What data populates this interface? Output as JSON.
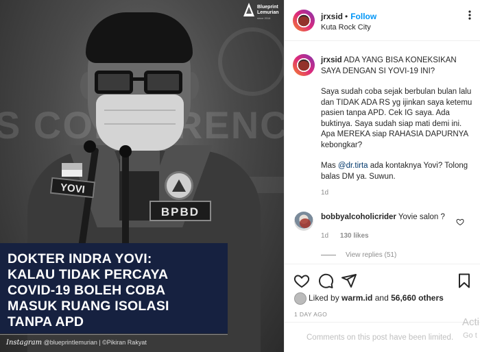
{
  "photo": {
    "background_text": "S CONFERENCE",
    "name_patch": "YOVI",
    "org_patch": "BPBD",
    "logo": {
      "line1": "Blueprint",
      "line2": "Lemurian",
      "tagline": "since 2016"
    },
    "headline": [
      "DOKTER INDRA YOVI:",
      "KALAU TIDAK PERCAYA",
      "COVID-19 BOLEH COBA",
      "MASUK RUANG ISOLASI",
      "TANPA APD"
    ],
    "credit": {
      "instagram": "Instagram",
      "text": "@blueprintlemurian | ©Pikiran Rakyat"
    }
  },
  "post": {
    "header": {
      "username": "jrxsid",
      "separator": "•",
      "follow": "Follow",
      "location": "Kuta Rock City"
    },
    "caption": {
      "username": "jrxsid",
      "first": "ADA YANG BISA KONEKSIKAN SAYA DENGAN SI YOVI-19 INI?",
      "para2": "Saya sudah coba sejak berbulan bulan lalu dan TIDAK ADA RS yg ijinkan saya ketemu pasien tanpa APD. Cek IG saya. Ada buktinya. Saya sudah siap mati demi ini. Apa MEREKA siap RAHASIA DAPURNYA kebongkar?",
      "para3_prefix": "Mas ",
      "mention": "@dr.tirta",
      "para3_suffix": " ada kontaknya Yovi? Tolong balas DM ya. Suwun.",
      "age": "1d"
    },
    "comment": {
      "username": "bobbyalcoholicrider",
      "text": "Yovie salon ?",
      "age": "1d",
      "likes": "130 likes",
      "view_replies": "View replies (51)"
    },
    "likes": {
      "prefix": "Liked by ",
      "user": "warm.id",
      "and": " and ",
      "others": "56,660 others"
    },
    "time_ago": "1 DAY AGO",
    "comments_off": "Comments on this post have been limited."
  },
  "windows": {
    "activate": "Acti",
    "activate_sub": "Go t"
  }
}
